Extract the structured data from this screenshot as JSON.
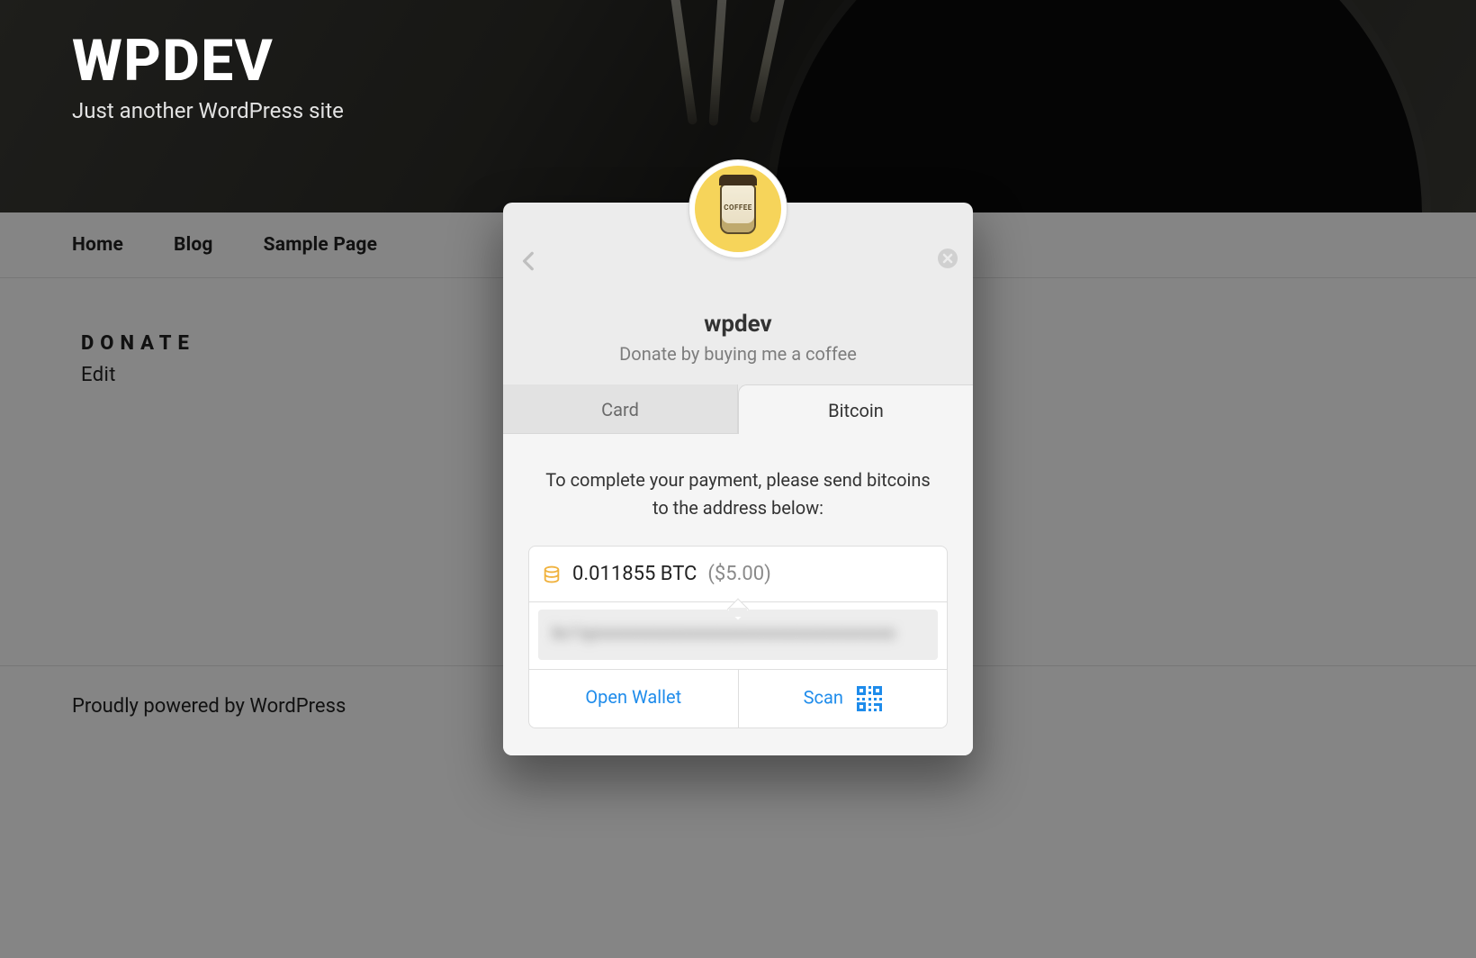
{
  "site": {
    "title": "WPDEV",
    "tagline": "Just another WordPress site"
  },
  "nav": {
    "items": [
      "Home",
      "Blog",
      "Sample Page"
    ]
  },
  "page": {
    "heading": "DONATE",
    "edit": "Edit"
  },
  "footer": {
    "text": "Proudly powered by WordPress"
  },
  "modal": {
    "avatar_label": "COFFEE",
    "recipient": "wpdev",
    "subtitle": "Donate by buying me a coffee",
    "tabs": {
      "card": "Card",
      "bitcoin": "Bitcoin"
    },
    "instructions": "To complete your payment, please send bitcoins to the address below:",
    "amount_btc": "0.011855 BTC",
    "amount_fiat": "($5.00)",
    "address_masked": "bc1qxxxxxxxxxxxxxxxxxxxxxxxxxxxxxxxxxx",
    "actions": {
      "open_wallet": "Open Wallet",
      "scan": "Scan"
    }
  }
}
